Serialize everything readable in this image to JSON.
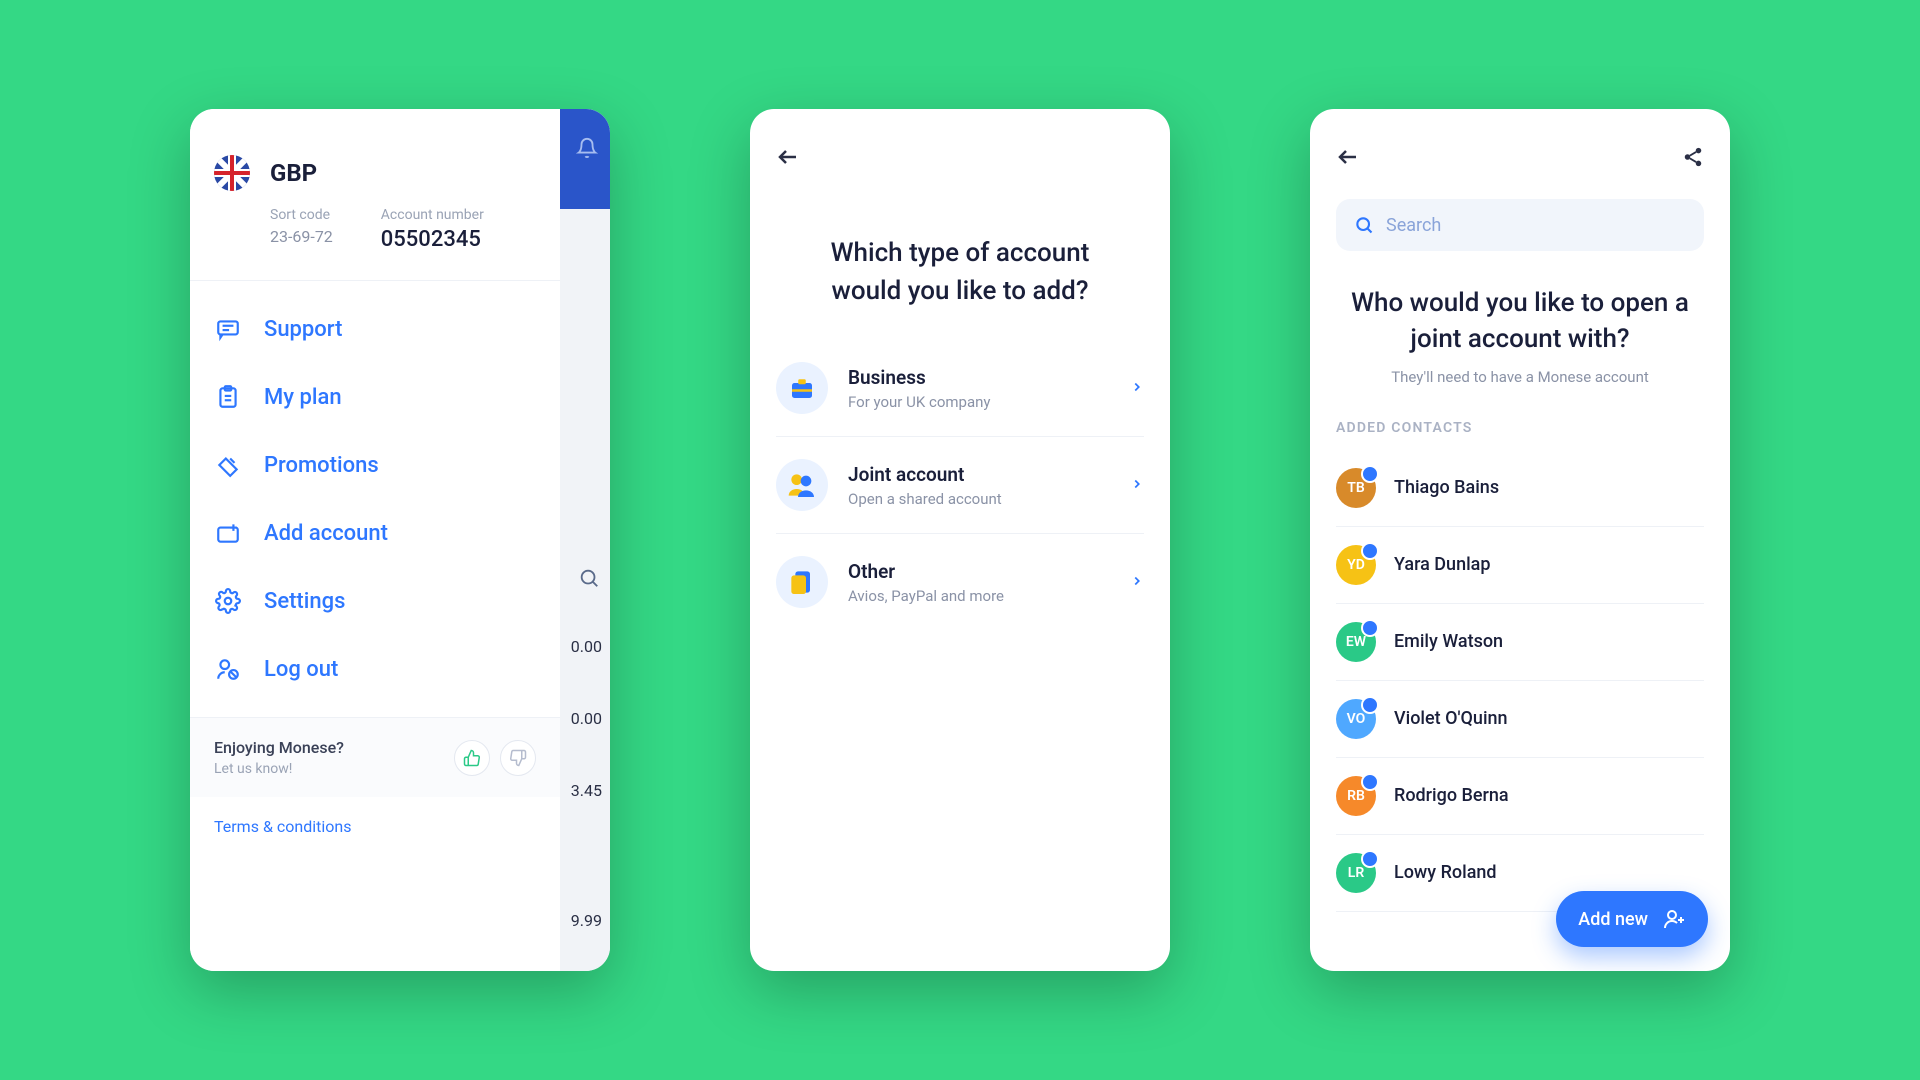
{
  "phone1": {
    "header": {
      "currency": "GBP",
      "sort_code_label": "Sort code",
      "sort_code": "23-69-72",
      "account_number_label": "Account number",
      "account_number": "05502345"
    },
    "menu": [
      {
        "name": "support",
        "label": "Support",
        "icon": "chat-icon"
      },
      {
        "name": "my-plan",
        "label": "My plan",
        "icon": "clipboard-icon"
      },
      {
        "name": "promotions",
        "label": "Promotions",
        "icon": "ticket-icon"
      },
      {
        "name": "add-account",
        "label": "Add account",
        "icon": "wallet-plus-icon"
      },
      {
        "name": "settings",
        "label": "Settings",
        "icon": "gear-icon"
      },
      {
        "name": "log-out",
        "label": "Log out",
        "icon": "user-logout-icon"
      }
    ],
    "feedback": {
      "title": "Enjoying Monese?",
      "subtitle": "Let us know!"
    },
    "terms": "Terms & conditions",
    "backdrop_amounts": [
      "0.00",
      "0.00",
      "3.45",
      "9.99"
    ]
  },
  "phone2": {
    "title": "Which type of account would you like to add?",
    "options": [
      {
        "name": "business",
        "title": "Business",
        "subtitle": "For your UK company",
        "icon": "briefcase-icon",
        "icon_bg": "#eaf2ff"
      },
      {
        "name": "joint-account",
        "title": "Joint account",
        "subtitle": "Open a shared account",
        "icon": "two-people-icon",
        "icon_bg": "#eaf2ff"
      },
      {
        "name": "other",
        "title": "Other",
        "subtitle": "Avios, PayPal and more",
        "icon": "cards-icon",
        "icon_bg": "#eaf2ff"
      }
    ]
  },
  "phone3": {
    "search_placeholder": "Search",
    "title": "Who would you like to open a joint account with?",
    "subtitle": "They'll need to have a Monese account",
    "section_label": "ADDED CONTACTS",
    "contacts": [
      {
        "initials": "TB",
        "name": "Thiago Bains",
        "color": "#d88a2a"
      },
      {
        "initials": "YD",
        "name": "Yara Dunlap",
        "color": "#f6c215"
      },
      {
        "initials": "EW",
        "name": "Emily Watson",
        "color": "#2ac987"
      },
      {
        "initials": "VO",
        "name": "Violet O'Quinn",
        "color": "#4fa8ff"
      },
      {
        "initials": "RB",
        "name": "Rodrigo Berna",
        "color": "#f6892a"
      },
      {
        "initials": "LR",
        "name": "Lowy Roland",
        "color": "#2ac987"
      }
    ],
    "fab_label": "Add new"
  }
}
